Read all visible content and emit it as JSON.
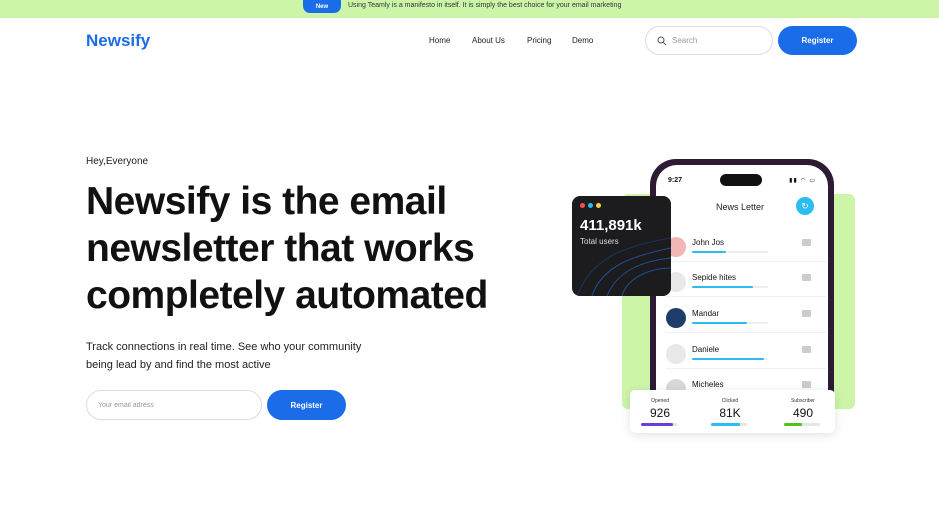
{
  "announcement": {
    "badge": "New",
    "message": "Using Teamly is a manifesto in itself. It is simply the best choice for your email marketing"
  },
  "header": {
    "logo": "Newsify",
    "nav": [
      "Home",
      "About Us",
      "Pricing",
      "Demo"
    ],
    "search_placeholder": "Search",
    "register_label": "Register"
  },
  "hero": {
    "greeting": "Hey,Everyone",
    "headline": "Newsify is the email newsletter that works completely automated",
    "subtext": "Track connections in real time. See who your community being lead by and find the most active",
    "email_placeholder": "Your email adress",
    "register_label": "Register"
  },
  "phone": {
    "time": "9:27",
    "title": "News Letter",
    "contacts": [
      {
        "name": "John Jos",
        "progress": 0.45,
        "avatar_color": "#f3b6b6"
      },
      {
        "name": "Sepide hites",
        "progress": 0.8,
        "avatar_color": "#e8e8e8"
      },
      {
        "name": "Mandar",
        "progress": 0.72,
        "avatar_color": "#1f3d6b"
      },
      {
        "name": "Daniele",
        "progress": 0.95,
        "avatar_color": "#e8e8e8"
      },
      {
        "name": "Micheles",
        "progress": 0.3,
        "avatar_color": "#d8d8d8"
      }
    ]
  },
  "users_card": {
    "value": "411,891k",
    "label": "Total users",
    "dot_colors": [
      "#ff4d4d",
      "#2dbcef",
      "#f5d142"
    ]
  },
  "stats": [
    {
      "label": "Opened",
      "value": "926",
      "fill": 0.9,
      "color": "#6b3fd4"
    },
    {
      "label": "Clicked",
      "value": "81K",
      "fill": 0.8,
      "color": "#2dbcef"
    },
    {
      "label": "Subscriber",
      "value": "490",
      "fill": 0.5,
      "color": "#4fc21a"
    }
  ]
}
